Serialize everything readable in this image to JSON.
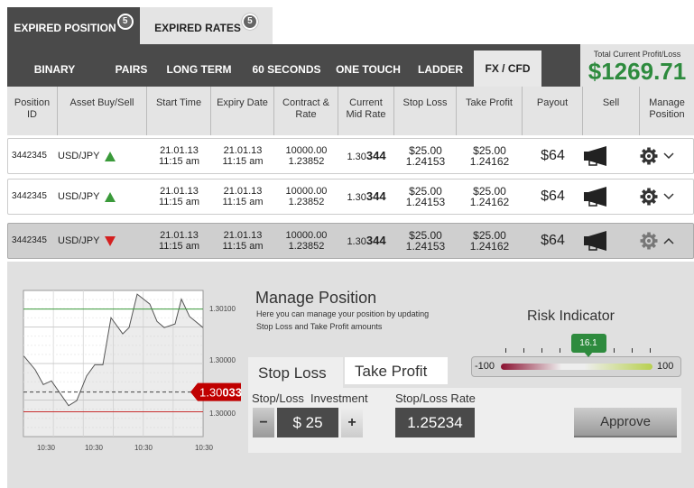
{
  "tabs": [
    {
      "label": "EXPIRED POSITION",
      "badge": "5",
      "active": true
    },
    {
      "label": "EXPIRED RATES",
      "badge": "5",
      "active": false
    }
  ],
  "nav": [
    "BINARY",
    "PAIRS",
    "LONG TERM",
    "60 SECONDS",
    "ONE TOUCH",
    "LADDER",
    "FX / CFD"
  ],
  "nav_active": "FX / CFD",
  "profit": {
    "label": "Total Current Profit/Loss",
    "value": "$1269.71",
    "color": "#2e8b3e"
  },
  "columns": [
    "Position ID",
    "Asset Buy/Sell",
    "Start Time",
    "Expiry Date",
    "Contract & Rate",
    "Current Mid Rate",
    "Stop Loss",
    "Take Profit",
    "Payout",
    "Sell",
    "Manage Position"
  ],
  "rows": [
    {
      "id": "3442345",
      "asset": "USD/JPY",
      "direction": "up",
      "start_date": "21.01.13",
      "start_time": "11:15 am",
      "expiry_date": "21.01.13",
      "expiry_time": "11:15 am",
      "contract": "10000.00",
      "rate": "1.23852",
      "mid_prefix": "1.30",
      "mid_suffix": "344",
      "stop_loss": "$25.00",
      "stop_rate": "1.24153",
      "take_profit": "$25.00",
      "take_rate": "1.24162",
      "payout": "$64",
      "expanded": false
    },
    {
      "id": "3442345",
      "asset": "USD/JPY",
      "direction": "up",
      "start_date": "21.01.13",
      "start_time": "11:15 am",
      "expiry_date": "21.01.13",
      "expiry_time": "11:15 am",
      "contract": "10000.00",
      "rate": "1.23852",
      "mid_prefix": "1.30",
      "mid_suffix": "344",
      "stop_loss": "$25.00",
      "stop_rate": "1.24153",
      "take_profit": "$25.00",
      "take_rate": "1.24162",
      "payout": "$64",
      "expanded": false
    },
    {
      "id": "3442345",
      "asset": "USD/JPY",
      "direction": "down",
      "start_date": "21.01.13",
      "start_time": "11:15 am",
      "expiry_date": "21.01.13",
      "expiry_time": "11:15 am",
      "contract": "10000.00",
      "rate": "1.23852",
      "mid_prefix": "1.30",
      "mid_suffix": "344",
      "stop_loss": "$25.00",
      "stop_rate": "1.24153",
      "take_profit": "$25.00",
      "take_rate": "1.24162",
      "payout": "$64",
      "expanded": true
    }
  ],
  "colors": {
    "up": "#3a9a3a",
    "down": "#d42020",
    "current": "#c00000"
  },
  "manage": {
    "title": "Manage Position",
    "desc1": "Here you can manage your position by updating",
    "desc2": "Stop Loss and Take Profit amounts",
    "tabs": [
      "Stop Loss",
      "Take Profit"
    ],
    "sl_label": "Stop/Loss  Investment",
    "sl_minus": "−",
    "sl_plus": "+",
    "sl_value": "$ 25",
    "rate_label": "Stop/Loss Rate",
    "rate_value": "1.25234",
    "approve": "Approve"
  },
  "risk": {
    "title": "Risk Indicator",
    "min": "-100",
    "max": "100",
    "value": 16.1,
    "value_label": "16.1"
  },
  "chart_data": {
    "type": "line",
    "values": [
      1.30062,
      1.30051,
      1.30039,
      1.30042,
      1.30022,
      1.30026,
      1.30046,
      1.30055,
      1.30055,
      1.30093,
      1.3008,
      1.30085,
      1.30112,
      1.30104,
      1.3009,
      1.30085,
      1.30088,
      1.30108,
      1.30094,
      1.30085
    ],
    "ytick_labels": [
      "1.30100",
      "1.30000",
      "1.30000"
    ],
    "xtick_labels": [
      "10:30",
      "10:30",
      "10:30",
      "10:30"
    ],
    "take_profit_level": 1.301,
    "stop_loss_level": 1.30017,
    "current": {
      "prefix": "1.30",
      "suffix": "033",
      "value": 1.30033
    },
    "grid": true
  }
}
